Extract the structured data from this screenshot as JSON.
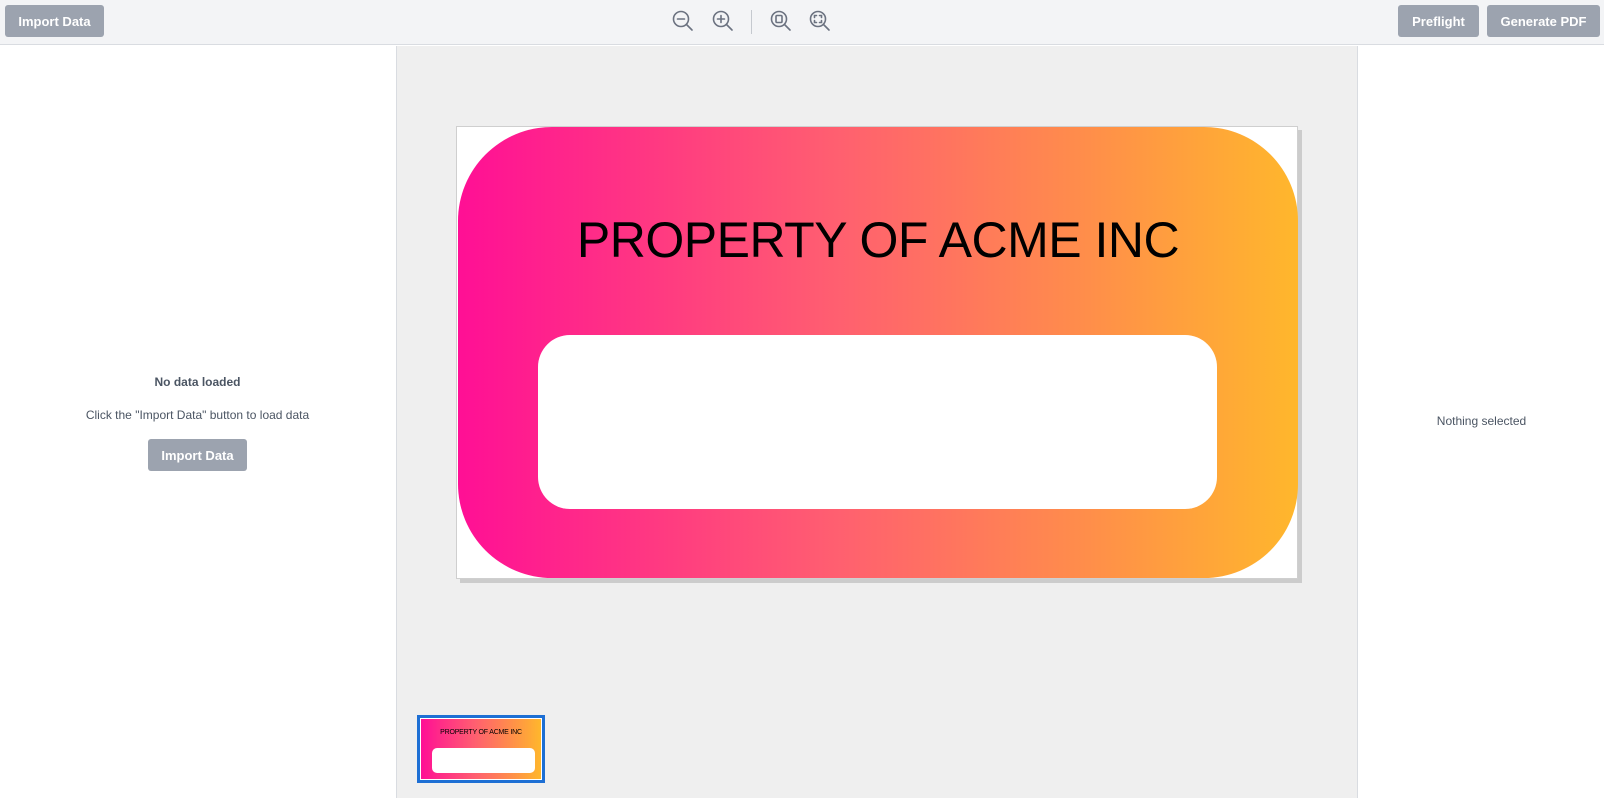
{
  "toolbar": {
    "import_label": "Import Data",
    "preflight_label": "Preflight",
    "generate_label": "Generate PDF",
    "icons": [
      "zoom-out-icon",
      "zoom-in-icon",
      "zoom-to-page-icon",
      "zoom-to-fit-icon"
    ]
  },
  "left_panel": {
    "title": "No data loaded",
    "hint": "Click the \"Import Data\" button to load data",
    "import_label": "Import Data"
  },
  "canvas": {
    "label_title": "PROPERTY OF ACME INC",
    "gradient_colors": [
      "#ff0f95",
      "#ff5f70",
      "#ff8e4a",
      "#ffb72c"
    ]
  },
  "thumbnail": {
    "label_title": "PROPERTY OF ACME INC",
    "selected": true,
    "selection_color": "#1d6fd4"
  },
  "right_panel": {
    "empty_text": "Nothing selected"
  }
}
